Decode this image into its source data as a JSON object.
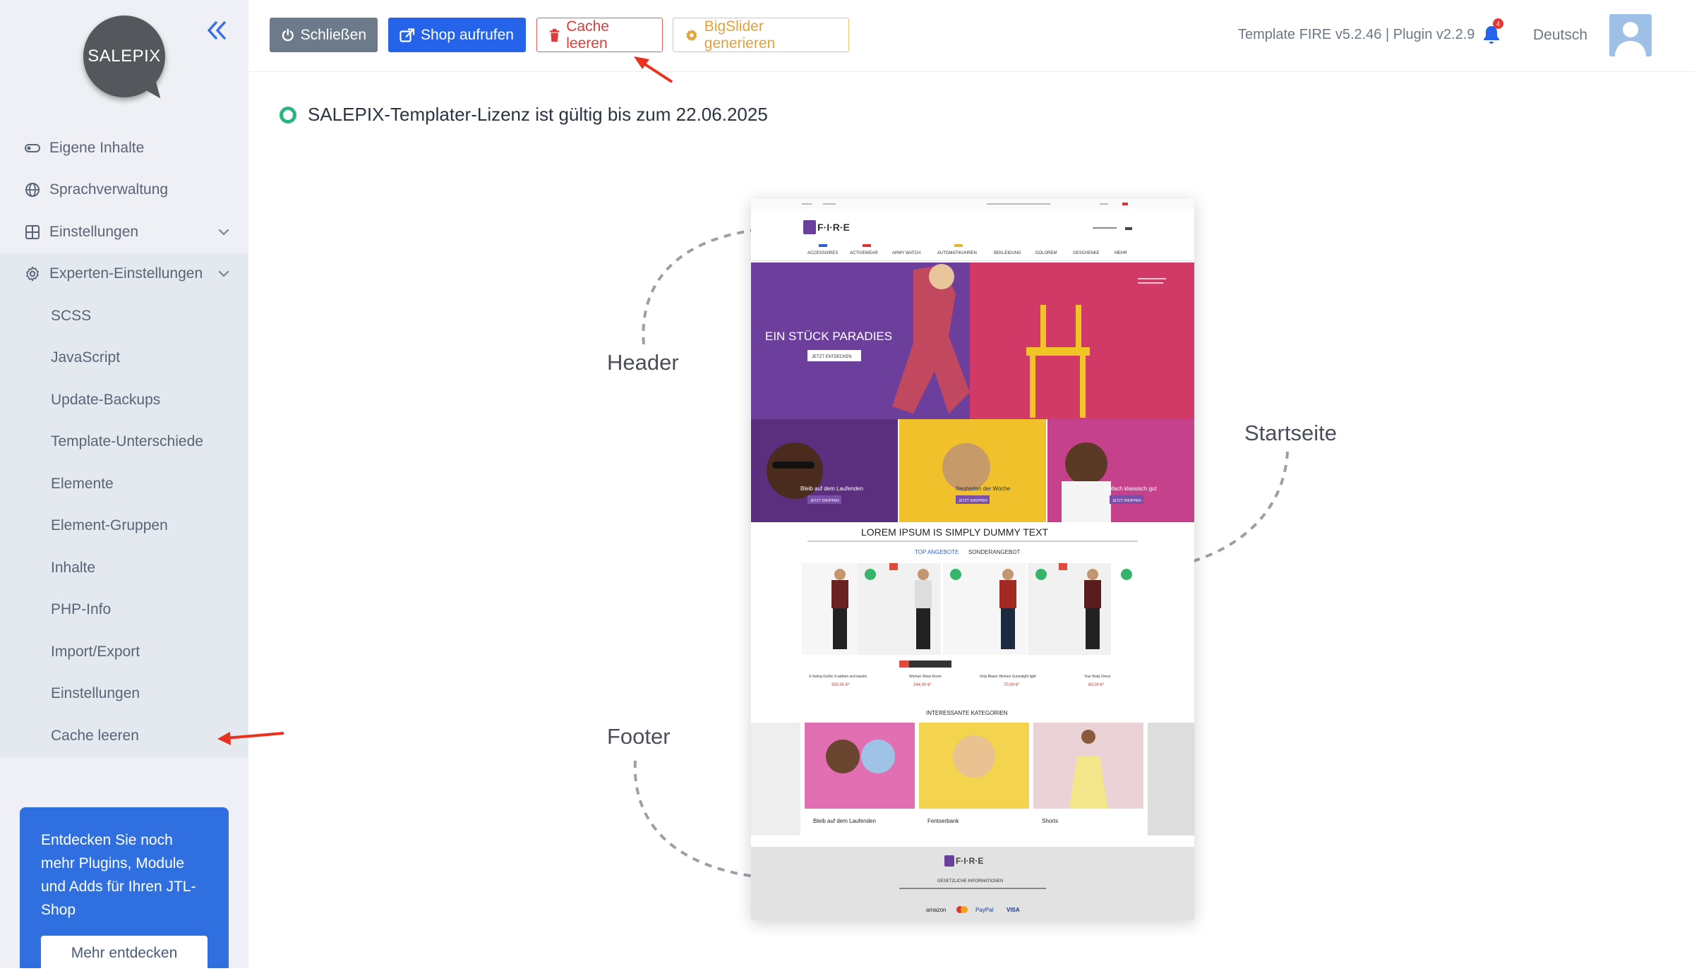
{
  "logo": {
    "text": "SALEPIX"
  },
  "sidebar": {
    "items": [
      {
        "label": "Eigene Inhalte",
        "icon": "toggle-icon"
      },
      {
        "label": "Sprachverwaltung",
        "icon": "globe-icon"
      },
      {
        "label": "Einstellungen",
        "icon": "grid-icon",
        "expandable": true
      },
      {
        "label": "Experten-Einstellungen",
        "icon": "gear-icon",
        "expandable": true,
        "expanded": true
      }
    ],
    "subitems": [
      "SCSS",
      "JavaScript",
      "Update-Backups",
      "Template-Unterschiede",
      "Elemente",
      "Element-Gruppen",
      "Inhalte",
      "PHP-Info",
      "Import/Export",
      "Einstellungen",
      "Cache leeren"
    ],
    "promo": {
      "text": "Entdecken Sie noch mehr Plugins, Module und Adds für Ihren JTL-Shop",
      "button": "Mehr entdecken"
    }
  },
  "toolbar": {
    "close_label": "Schließen",
    "shop_label": "Shop aufrufen",
    "cache_label": "Cache leeren",
    "slider_label": "BigSlider generieren",
    "version": "Template FIRE v5.2.46 | Plugin v2.2.9",
    "notification_count": "4",
    "language": "Deutsch"
  },
  "colors": {
    "primary": "#2563eb",
    "danger": "#e03a3a",
    "warning": "#e3a03b",
    "success": "#2cb67d",
    "sidebar_bg": "#eef0f5"
  },
  "license": {
    "text": "SALEPIX-Templater-Lizenz ist gültig bis zum 22.06.2025"
  },
  "annotations": {
    "header": "Header",
    "startseite": "Startseite",
    "footer": "Footer"
  },
  "preview": {
    "brand": "F·I·R·E",
    "nav": [
      "ACCESSOIRES",
      "ACTIVEWEAR",
      "ARMY WATCH",
      "AUTOMATIKUHREN",
      "BEKLEIDUNG",
      "DOLOREM",
      "GESCHENKE",
      "MEHR"
    ],
    "hero_title": "EIN STÜCK PARADIES",
    "hero_button": "JETZT ENTDECKEN",
    "tiles": [
      {
        "text": "Bleib auf dem Laufenden",
        "button": "JETZT SHOPPEN"
      },
      {
        "text": "Neuheiten der Woche",
        "button": "JETZT SHOPPEN"
      },
      {
        "text": "Einfach klassisch gut",
        "button": "JETZT SHOPPEN"
      }
    ],
    "section_title": "LOREM IPSUM IS SIMPLY DUMMY TEXT",
    "tabs": [
      "TOP ANGEBOTE",
      "SONDERANGEBOT"
    ],
    "products": [
      {
        "name": "X-Swing Größe S wählen und kaufen",
        "price": "300,00 €*"
      },
      {
        "name": "Woman Show Room",
        "price": "244,00 €*"
      },
      {
        "name": "Only Blazer Women Sunnylight light",
        "price": "70,00 €*"
      },
      {
        "name": "Your Body Dress",
        "price": "60,00 €*"
      }
    ],
    "categories_title": "INTERESSANTE KATEGORIEN",
    "categories": [
      "Bleib auf dem Laufenden",
      "Fentserbank",
      "Shorts"
    ],
    "footer_title": "GESETZLICHE INFORMATIONEN",
    "payments": [
      "amazon",
      "PayPal",
      "VISA"
    ]
  }
}
